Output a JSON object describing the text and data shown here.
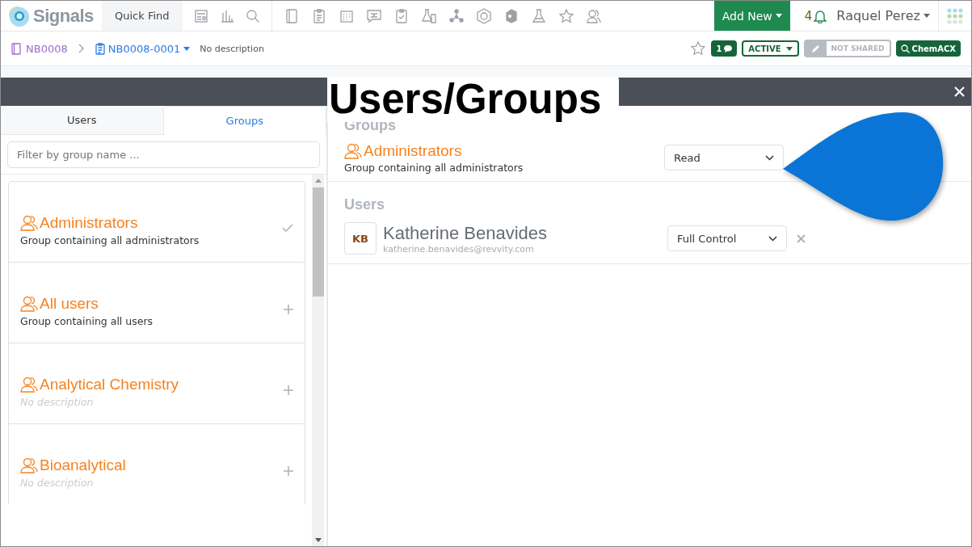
{
  "app": {
    "logo_text": "Signals",
    "quick_find": "Quick Find",
    "add_new": "Add New",
    "notification_count": "4",
    "user_name": "Raquel Perez"
  },
  "breadcrumb": {
    "notebook": "NB0008",
    "experiment": "NB0008-0001",
    "description": "No description"
  },
  "entry_actions": {
    "comment_count": "1",
    "status": "ACTIVE",
    "sharing": "NOT SHARED",
    "chemacx": "ChemACX"
  },
  "overlay_title": "Users/Groups",
  "left_panel": {
    "tabs": [
      {
        "label": "Users",
        "selected": false
      },
      {
        "label": "Groups",
        "selected": true
      }
    ],
    "filter_placeholder": "Filter by group name ...",
    "groups": [
      {
        "name": "Administrators",
        "description": "Group containing all administrators",
        "has_description": true,
        "added": true
      },
      {
        "name": "All users",
        "description": "Group containing all users",
        "has_description": true,
        "added": false
      },
      {
        "name": "Analytical Chemistry",
        "description": "No description",
        "has_description": false,
        "added": false
      },
      {
        "name": "Bioanalytical",
        "description": "No description",
        "has_description": false,
        "added": false
      }
    ]
  },
  "right_panel": {
    "groups_heading": "Groups",
    "groups": [
      {
        "name": "Administrators",
        "description": "Group containing all administrators",
        "permission": "Read"
      }
    ],
    "users_heading": "Users",
    "users": [
      {
        "initials": "KB",
        "name": "Katherine Benavides",
        "email": "katherine.benavides@revvity.com",
        "permission": "Full Control",
        "removable": true
      }
    ]
  }
}
